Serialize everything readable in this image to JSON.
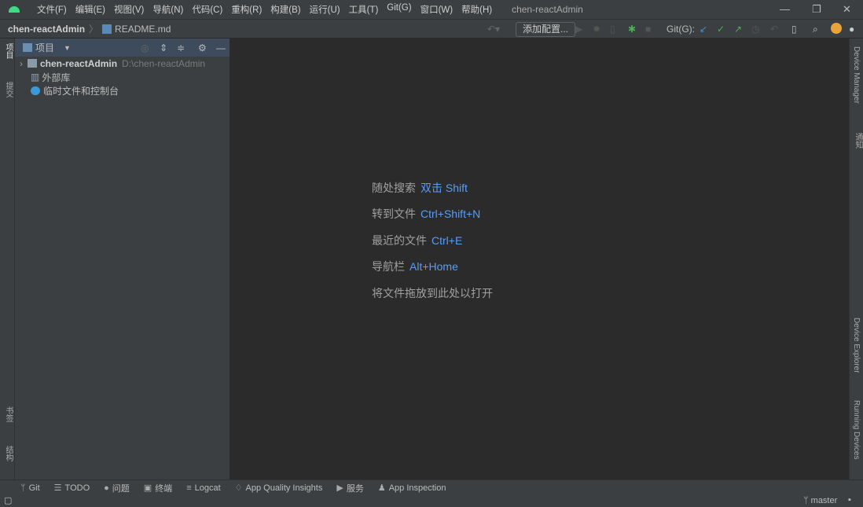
{
  "menu": [
    "文件(F)",
    "编辑(E)",
    "视图(V)",
    "导航(N)",
    "代码(C)",
    "重构(R)",
    "构建(B)",
    "运行(U)",
    "工具(T)",
    "Git(G)",
    "窗口(W)",
    "帮助(H)"
  ],
  "app_title": "chen-reactAdmin",
  "breadcrumb": {
    "project": "chen-reactAdmin",
    "file": "README.md"
  },
  "toolbar": {
    "add_config": "添加配置...",
    "git_label": "Git(G):"
  },
  "left_strip": {
    "project": "项目",
    "commit": "提交",
    "bookmarks": "书签",
    "structure": "结构"
  },
  "panel": {
    "title": "项目",
    "tree": [
      {
        "name": "chen-reactAdmin",
        "path": "D:\\chen-reactAdmin"
      },
      {
        "name": "外部库"
      },
      {
        "name": "临时文件和控制台"
      }
    ]
  },
  "hints": [
    {
      "label": "随处搜索",
      "key": "双击 Shift"
    },
    {
      "label": "转到文件",
      "key": "Ctrl+Shift+N"
    },
    {
      "label": "最近的文件",
      "key": "Ctrl+E"
    },
    {
      "label": "导航栏",
      "key": "Alt+Home"
    },
    {
      "label": "将文件拖放到此处以打开",
      "key": ""
    }
  ],
  "right_strip": {
    "device_manager": "Device Manager",
    "notifications": "通知",
    "device_explorer": "Device Explorer",
    "running_devices": "Running Devices"
  },
  "bottom_tools": [
    "Git",
    "TODO",
    "问题",
    "终端",
    "Logcat",
    "App Quality Insights",
    "服务",
    "App Inspection"
  ],
  "status": {
    "branch": "master"
  },
  "colors": {
    "accent": "#589df6",
    "panel": "#3c3f41",
    "editor": "#2b2b2b",
    "android": "#3ddc84"
  }
}
